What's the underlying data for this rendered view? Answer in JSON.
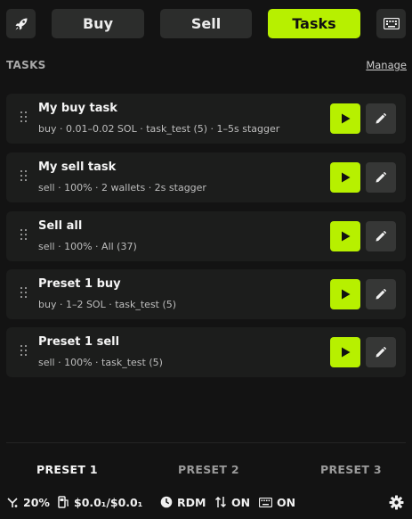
{
  "topbar": {
    "left_icon": "rocket-icon",
    "tabs": [
      {
        "label": "Buy",
        "active": false
      },
      {
        "label": "Sell",
        "active": false
      },
      {
        "label": "Tasks",
        "active": true
      }
    ],
    "right_icon": "keyboard-icon"
  },
  "tasks": {
    "title": "TASKS",
    "manage_label": "Manage",
    "items": [
      {
        "name": "My buy task",
        "desc": "buy · 0.01–0.02 SOL · task_test (5) · 1–5s stagger"
      },
      {
        "name": "My sell task",
        "desc": "sell · 100% · 2 wallets · 2s stagger"
      },
      {
        "name": "Sell all",
        "desc": "sell · 100% · All (37)"
      },
      {
        "name": "Preset 1 buy",
        "desc": "buy · 1–2 SOL · task_test (5)"
      },
      {
        "name": "Preset 1 sell",
        "desc": "sell · 100% · task_test (5)"
      }
    ]
  },
  "presets": {
    "tabs": [
      {
        "label": "PRESET 1",
        "active": true
      },
      {
        "label": "PRESET 2",
        "active": false
      },
      {
        "label": "PRESET 3",
        "active": false
      }
    ]
  },
  "status": {
    "slippage": "20%",
    "fee": "$0.0₁/$0.0₁",
    "mode": "RDM",
    "transfer": "ON",
    "keyboard": "ON"
  },
  "colors": {
    "accent": "#b7f000",
    "background": "#131313",
    "card": "#1c1d1c"
  }
}
